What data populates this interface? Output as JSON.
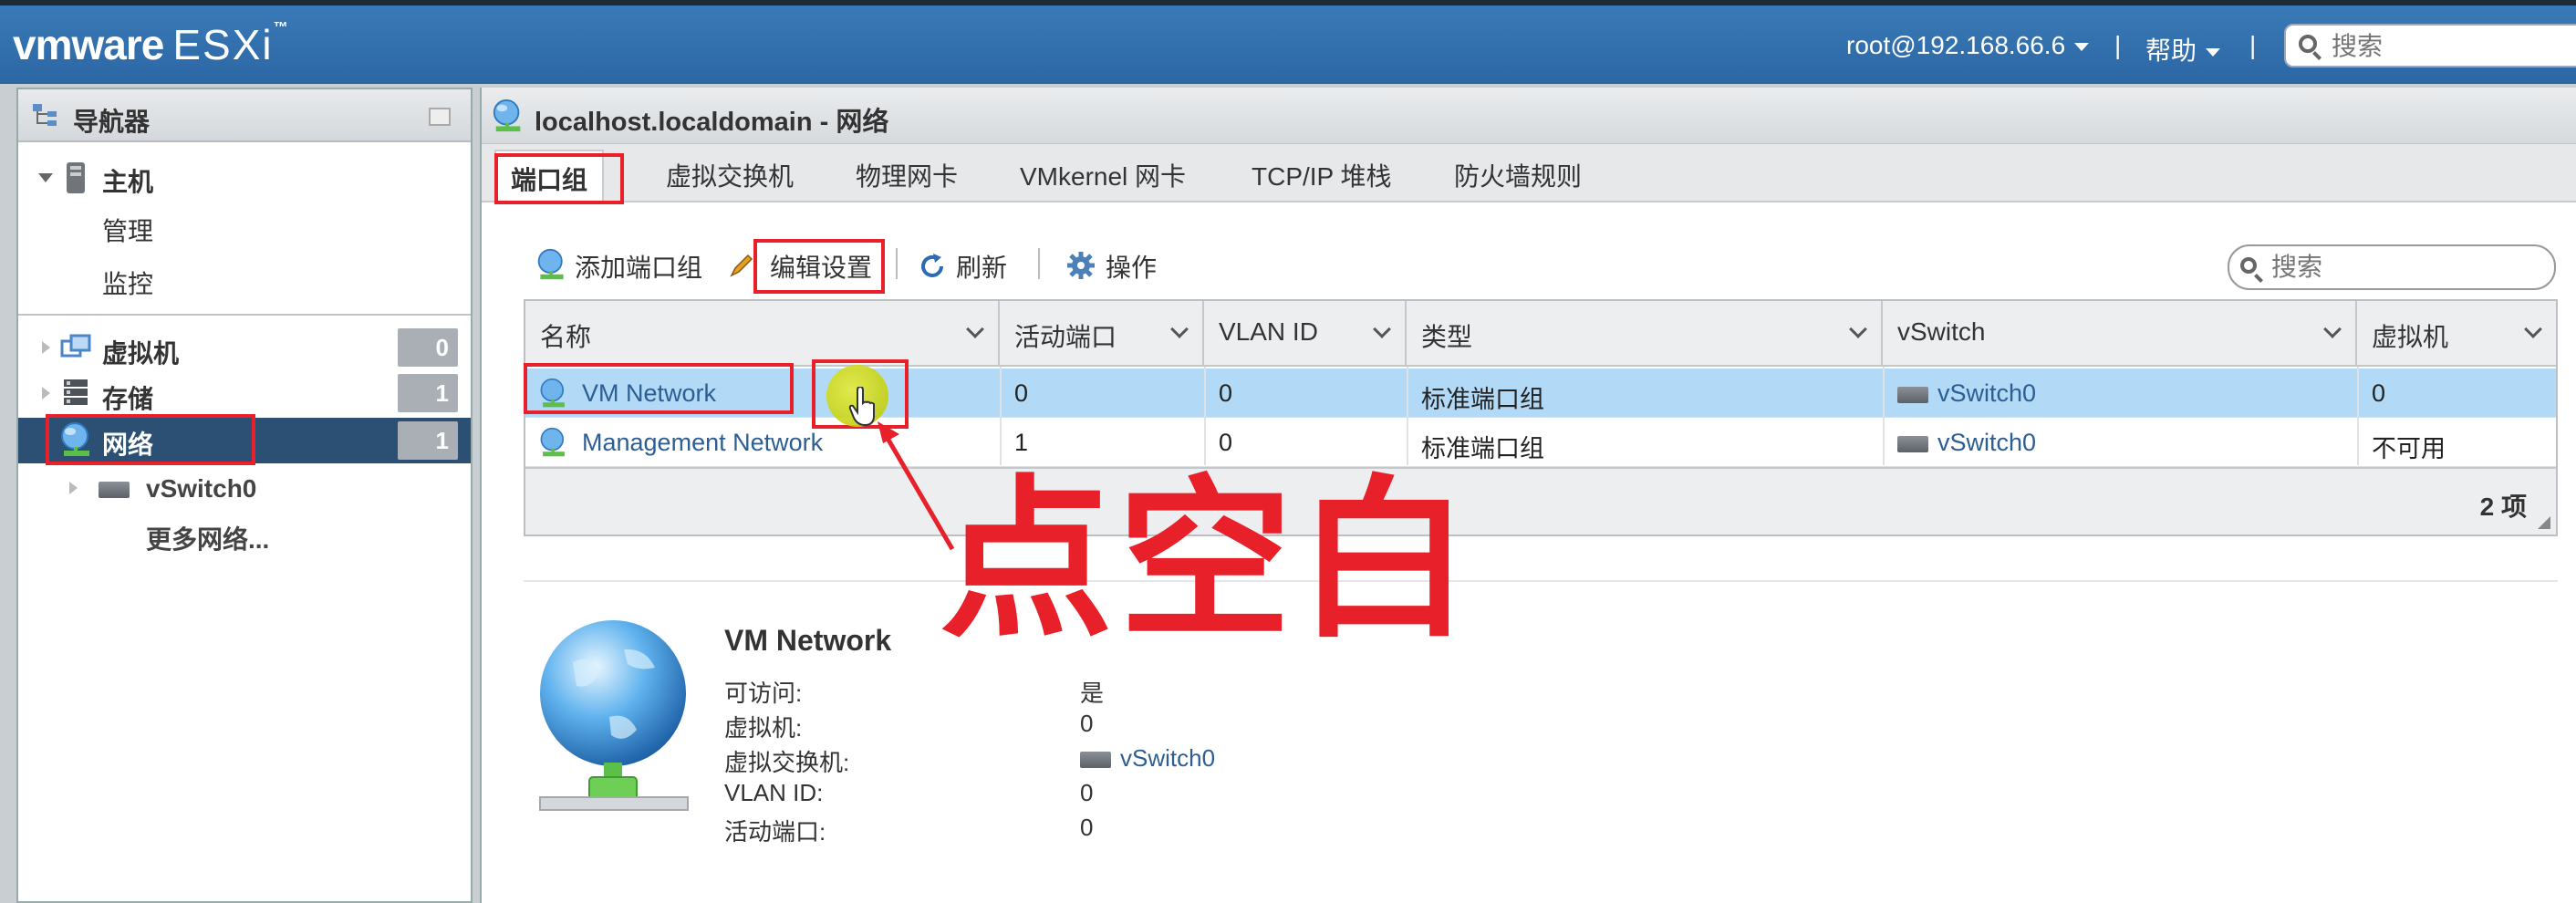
{
  "header": {
    "logo_vm": "vmware",
    "logo_product": "ESXi",
    "logo_tm": "™",
    "user": "root@192.168.66.6",
    "separator": "|",
    "help": "帮助",
    "search_placeholder": "搜索"
  },
  "navigator": {
    "title": "导航器",
    "host": "主机",
    "host_items": [
      "管理",
      "监控"
    ],
    "sections": [
      {
        "label": "虚拟机",
        "count": "0"
      },
      {
        "label": "存储",
        "count": "1"
      },
      {
        "label": "网络",
        "count": "1"
      }
    ],
    "network_children": [
      "vSwitch0",
      "更多网络..."
    ]
  },
  "main": {
    "title": "localhost.localdomain - 网络",
    "tabs": [
      "端口组",
      "虚拟交换机",
      "物理网卡",
      "VMkernel 网卡",
      "TCP/IP 堆栈",
      "防火墙规则"
    ],
    "toolbar": {
      "add": "添加端口组",
      "edit": "编辑设置",
      "refresh": "刷新",
      "actions": "操作",
      "search_placeholder": "搜索"
    },
    "table": {
      "columns": [
        "名称",
        "活动端口",
        "VLAN ID",
        "类型",
        "vSwitch",
        "虚拟机"
      ],
      "rows": [
        {
          "name": "VM Network",
          "active_ports": "0",
          "vlan": "0",
          "type": "标准端口组",
          "vswitch": "vSwitch0",
          "vms": "0",
          "selected": true
        },
        {
          "name": "Management Network",
          "active_ports": "1",
          "vlan": "0",
          "type": "标准端口组",
          "vswitch": "vSwitch0",
          "vms": "不可用",
          "selected": false
        }
      ],
      "count": "2 项"
    },
    "detail": {
      "title": "VM Network",
      "fields": [
        {
          "label": "可访问:",
          "value": "是"
        },
        {
          "label": "虚拟机:",
          "value": "0"
        },
        {
          "label": "虚拟交换机:",
          "value": "vSwitch0"
        },
        {
          "label": "VLAN ID:",
          "value": "0"
        },
        {
          "label": "活动端口:",
          "value": "0"
        }
      ]
    }
  },
  "annotation": {
    "text": "点空白",
    "color": "#e8202a"
  },
  "colors": {
    "topbar": "#2f6dab",
    "nav_selected": "#2c4f74",
    "row_selected": "#b2d9f5",
    "link": "#2d5e93"
  }
}
